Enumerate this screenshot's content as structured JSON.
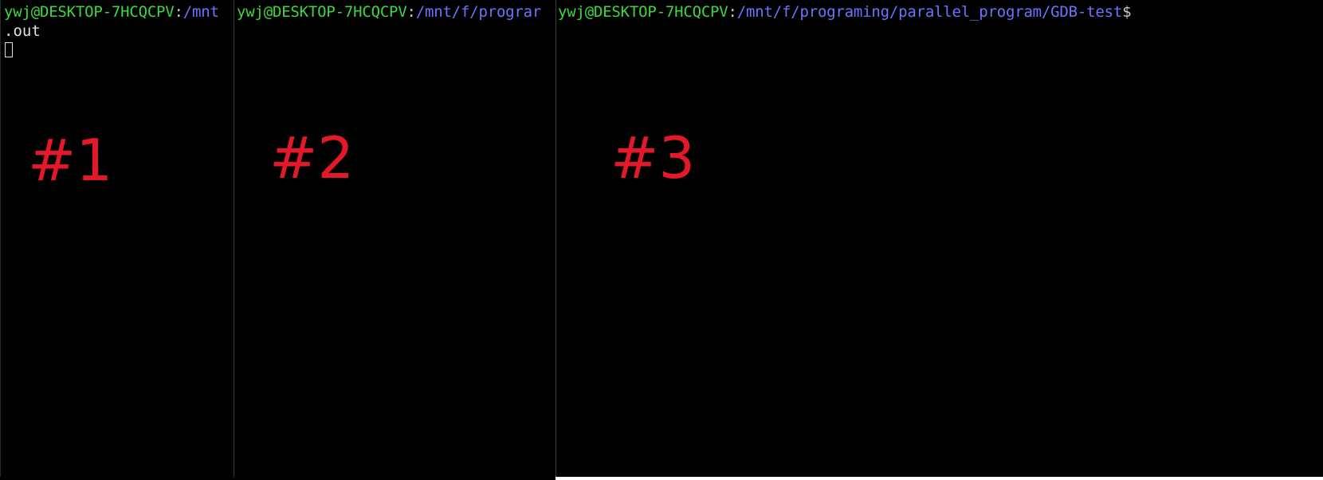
{
  "terminal": {
    "panes": [
      {
        "user_host": "ywj@DESKTOP-7HCQCPV",
        "colon": ":",
        "path": "/mnt",
        "dollar": "",
        "output": ".out",
        "label": "#1"
      },
      {
        "user_host": "ywj@DESKTOP-7HCQCPV",
        "colon": ":",
        "path": "/mnt/f/prograr",
        "dollar": "",
        "output": "",
        "label": "#2"
      },
      {
        "user_host": "ywj@DESKTOP-7HCQCPV",
        "colon": ":",
        "path": "/mnt/f/programing/parallel_program/GDB-test",
        "dollar": "$",
        "output": "",
        "label": "#3"
      }
    ]
  },
  "colors": {
    "background": "#000000",
    "user_host": "#3cd93c",
    "path": "#6f72ff",
    "text": "#e0e0e0",
    "annotation": "#e3192a"
  },
  "icons": {
    "cursor": "block-cursor-icon"
  }
}
